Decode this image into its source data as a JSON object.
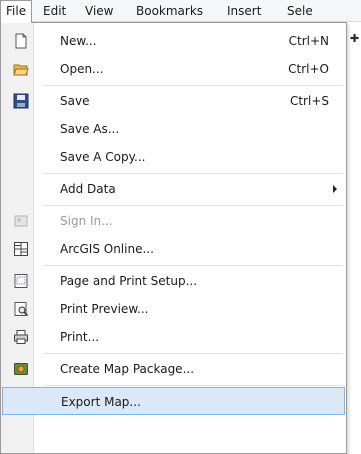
{
  "menubar": {
    "items": [
      {
        "label": "File",
        "active": true
      },
      {
        "label": "Edit"
      },
      {
        "label": "View"
      },
      {
        "label": "Bookmarks"
      },
      {
        "label": "Insert"
      },
      {
        "label": "Sele"
      }
    ]
  },
  "file_menu": {
    "items": [
      {
        "label": "New...",
        "shortcut": "Ctrl+N",
        "icon": "new-document-icon"
      },
      {
        "label": "Open...",
        "shortcut": "Ctrl+O",
        "icon": "open-folder-icon"
      },
      {
        "label": "Save",
        "shortcut": "Ctrl+S",
        "icon": "save-disk-icon"
      },
      {
        "label": "Save As..."
      },
      {
        "label": "Save A Copy..."
      },
      {
        "label": "Add Data",
        "submenu": true
      },
      {
        "label": "Sign In...",
        "disabled": true,
        "icon": "sign-in-icon"
      },
      {
        "label": "ArcGIS Online...",
        "icon": "grid-icon"
      },
      {
        "label": "Page and Print Setup...",
        "icon": "page-setup-icon"
      },
      {
        "label": "Print Preview...",
        "icon": "print-preview-icon"
      },
      {
        "label": "Print...",
        "icon": "printer-icon"
      },
      {
        "label": "Create Map Package...",
        "icon": "map-package-icon"
      },
      {
        "label": "Export Map...",
        "highlighted": true
      }
    ]
  },
  "colors": {
    "highlight_fill": "#dbe8f8",
    "highlight_border": "#7eb4ea",
    "disabled_text": "#9a9a9a"
  }
}
